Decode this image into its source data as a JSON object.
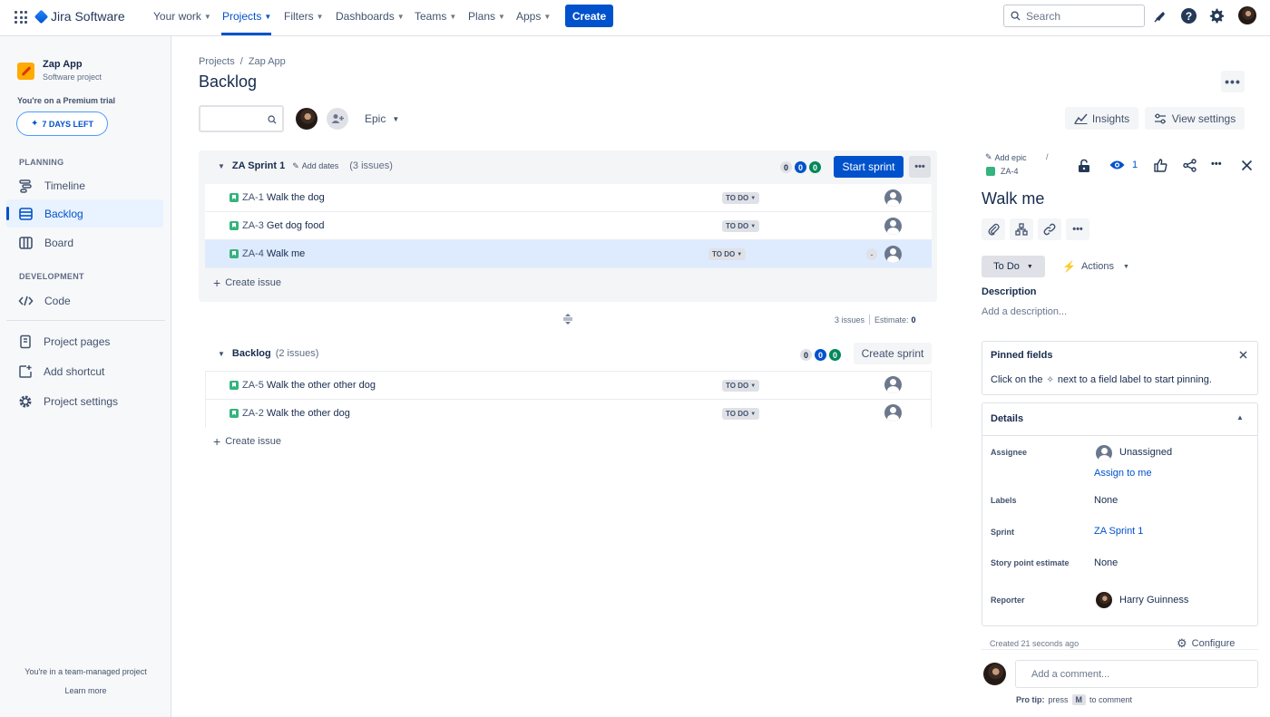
{
  "topnav": {
    "app_name": "Jira Software",
    "items": [
      {
        "label": "Your work"
      },
      {
        "label": "Projects"
      },
      {
        "label": "Filters"
      },
      {
        "label": "Dashboards"
      },
      {
        "label": "Teams"
      },
      {
        "label": "Plans"
      },
      {
        "label": "Apps"
      }
    ],
    "create_label": "Create",
    "search_placeholder": "Search"
  },
  "sidebar": {
    "project_name": "Zap App",
    "project_type": "Software project",
    "trial_text": "You're on a Premium trial",
    "trial_button": "7 DAYS LEFT",
    "planning_heading": "PLANNING",
    "planning_items": [
      {
        "label": "Timeline"
      },
      {
        "label": "Backlog"
      },
      {
        "label": "Board"
      }
    ],
    "development_heading": "DEVELOPMENT",
    "dev_items": [
      {
        "label": "Code"
      }
    ],
    "other_items": [
      {
        "label": "Project pages"
      },
      {
        "label": "Add shortcut"
      },
      {
        "label": "Project settings"
      }
    ],
    "footer_text": "You're in a team-managed project",
    "learn_more": "Learn more"
  },
  "main": {
    "breadcrumb": {
      "projects": "Projects",
      "separator": "/",
      "project": "Zap App"
    },
    "title": "Backlog",
    "epic_filter": "Epic",
    "insights_label": "Insights",
    "view_settings_label": "View settings",
    "sprint": {
      "name": "ZA Sprint 1",
      "add_dates": "Add dates",
      "issue_count": "(3 issues)",
      "counts": [
        "0",
        "0",
        "0"
      ],
      "start_label": "Start sprint",
      "issues": [
        {
          "key": "ZA-1",
          "summary": "Walk the dog",
          "status": "TO DO",
          "estimate": ""
        },
        {
          "key": "ZA-3",
          "summary": "Get dog food",
          "status": "TO DO",
          "estimate": ""
        },
        {
          "key": "ZA-4",
          "summary": "Walk me",
          "status": "TO DO",
          "estimate": "-"
        }
      ],
      "create_issue": "Create issue",
      "footer_issues": "3 issues",
      "footer_estimate_label": "Estimate:",
      "footer_estimate_value": "0"
    },
    "backlog": {
      "name": "Backlog",
      "issue_count": "(2 issues)",
      "counts": [
        "0",
        "0",
        "0"
      ],
      "create_sprint_label": "Create sprint",
      "issues": [
        {
          "key": "ZA-5",
          "summary": "Walk the other other dog",
          "status": "TO DO"
        },
        {
          "key": "ZA-2",
          "summary": "Walk the other dog",
          "status": "TO DO"
        }
      ],
      "create_issue": "Create issue"
    }
  },
  "detail": {
    "add_epic": "Add epic",
    "separator": "/",
    "issue_key": "ZA-4",
    "watch_count": "1",
    "title": "Walk me",
    "status_label": "To Do",
    "actions_label": "Actions",
    "description_label": "Description",
    "description_placeholder": "Add a description...",
    "pinned": {
      "title": "Pinned fields",
      "text_before": "Click on the",
      "text_after": "next to a field label to start pinning."
    },
    "details_title": "Details",
    "fields": {
      "assignee_label": "Assignee",
      "assignee_value": "Unassigned",
      "assign_to_me": "Assign to me",
      "labels_label": "Labels",
      "labels_value": "None",
      "sprint_label": "Sprint",
      "sprint_value": "ZA Sprint 1",
      "story_points_label": "Story point estimate",
      "story_points_value": "None",
      "reporter_label": "Reporter",
      "reporter_value": "Harry Guinness"
    },
    "created_text": "Created 21 seconds ago",
    "configure_label": "Configure",
    "comment_placeholder": "Add a comment...",
    "protip_label": "Pro tip:",
    "protip_press": "press",
    "protip_key": "M",
    "protip_rest": "to comment"
  },
  "colors": {
    "brand_blue": "#0052cc",
    "story_green": "#36b37e",
    "selected_row": "#deebff",
    "count_green": "#00875a"
  }
}
